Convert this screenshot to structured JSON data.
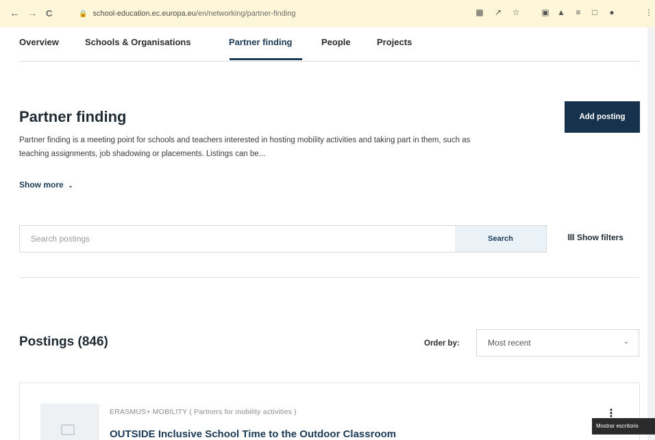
{
  "browser": {
    "back": "←",
    "forward": "→",
    "reload": "C",
    "url_host": "school-education.ec.europa.eu",
    "url_path": "/en/networking/partner-finding",
    "icons": [
      "translate-icon",
      "share-icon",
      "star-icon",
      "extension-icon",
      "puzzle-icon",
      "reading-list-icon",
      "sidebar-icon",
      "profile-icon",
      "kebab-menu-icon"
    ]
  },
  "tabs": [
    {
      "label": "Overview"
    },
    {
      "label": "Schools & Organisations"
    },
    {
      "label": "Partner finding"
    },
    {
      "label": "People"
    },
    {
      "label": "Projects"
    }
  ],
  "header": {
    "title": "Partner finding",
    "description": "Partner finding is a meeting point for schools and teachers interested in hosting mobility activities and taking part in them, such as teaching assignments, job shadowing or placements. Listings can be...",
    "show_more": "Show more",
    "add_posting": "Add posting"
  },
  "search": {
    "placeholder": "Search postings",
    "button": "Search",
    "show_filters": "Show filters"
  },
  "postings": {
    "title": "Postings (846)",
    "order_label": "Order by:",
    "order_value": "Most recent"
  },
  "card": {
    "category": "ERASMUS+ MOBILITY ( Partners for mobility activities )",
    "title": "OUTSIDE Inclusive School Time to the Outdoor Classroom"
  },
  "tooltip": "Mostrar escritorio"
}
